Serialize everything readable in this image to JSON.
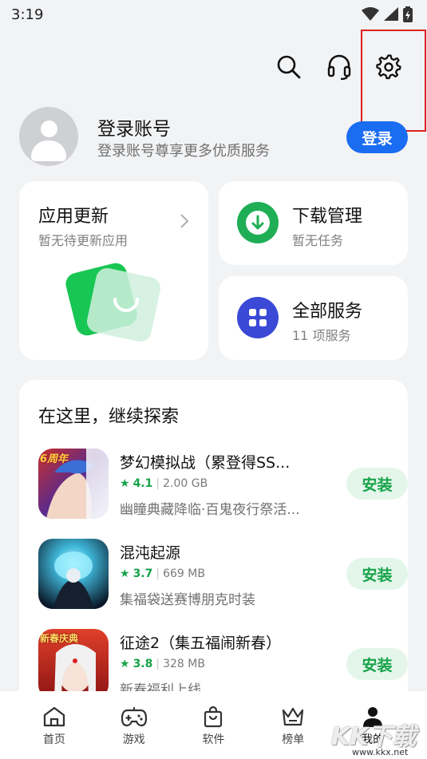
{
  "status_bar": {
    "time": "3:19"
  },
  "profile": {
    "title": "登录账号",
    "subtitle": "登录账号尊享更多优质服务",
    "login_label": "登录"
  },
  "cards": {
    "update": {
      "title": "应用更新",
      "subtitle": "暂无待更新应用"
    },
    "download": {
      "title": "下载管理",
      "subtitle": "暂无任务"
    },
    "services": {
      "title": "全部服务",
      "subtitle": "11 项服务"
    }
  },
  "explore": {
    "title": "在这里，继续探索",
    "install_label": "安装",
    "apps": [
      {
        "name": "梦幻模拟战（累登得SS...",
        "rating": "4.1",
        "size": "2.00 GB",
        "desc": "幽瞳典藏降临·百鬼夜行祭活...",
        "badge": "6周年"
      },
      {
        "name": "混沌起源",
        "rating": "3.7",
        "size": "669 MB",
        "desc": "集福袋送赛博朋克时装"
      },
      {
        "name": "征途2（集五福闹新春）",
        "rating": "3.8",
        "size": "328 MB",
        "desc": "新春福利上线",
        "badge": "新春庆典"
      }
    ]
  },
  "nav": [
    {
      "label": "首页",
      "icon": "home-icon"
    },
    {
      "label": "游戏",
      "icon": "gamepad-icon"
    },
    {
      "label": "软件",
      "icon": "shopping-bag-icon"
    },
    {
      "label": "榜单",
      "icon": "crown-icon"
    },
    {
      "label": "我的",
      "icon": "person-icon"
    }
  ],
  "watermark": {
    "logo": "KK下载",
    "url": "www.kkx.net"
  },
  "colors": {
    "accent": "#1a6cf0",
    "green": "#17a34a",
    "highlight": "#e02020"
  }
}
